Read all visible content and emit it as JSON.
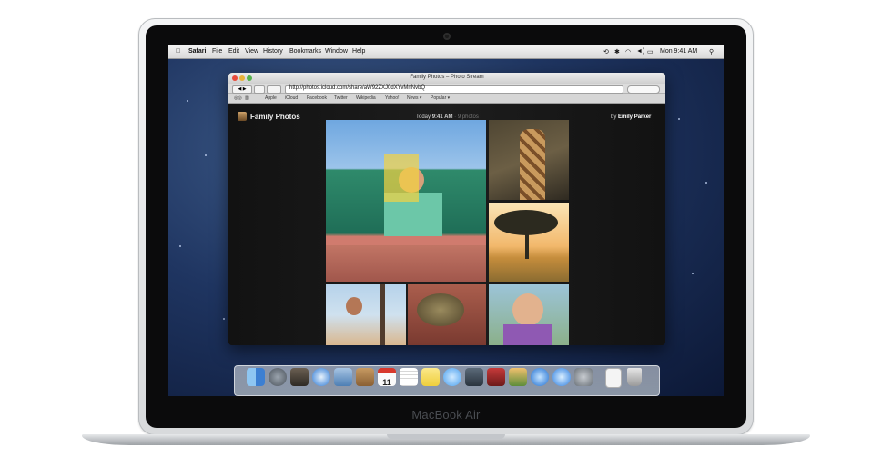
{
  "device": {
    "brand_label": "MacBook Air"
  },
  "menubar": {
    "apple_icon": "apple-icon",
    "items": [
      "Safari",
      "File",
      "Edit",
      "View",
      "History",
      "Bookmarks",
      "Window",
      "Help"
    ],
    "clock": "Mon 9:41 AM"
  },
  "window": {
    "title": "Family Photos – Photo Stream",
    "url": "http://photos.icloud.com/share/aW92ZXJ0dXYvMnNvbQ",
    "bookmarks": [
      "Apple",
      "iCloud",
      "Facebook",
      "Twitter",
      "Wikipedia",
      "Yahoo!",
      "News ▾",
      "Popular ▾"
    ]
  },
  "stream": {
    "title": "Family Photos",
    "today_label": "Today",
    "time": "9:41 AM",
    "count": "· 9 photos",
    "by_prefix": "by",
    "author": "Emily Parker"
  },
  "dock": {
    "icons": [
      "finder-icon",
      "launchpad-icon",
      "mission-control-icon",
      "safari-icon",
      "mail-icon",
      "contacts-icon",
      "calendar-icon",
      "reminders-icon",
      "notes-icon",
      "messages-icon",
      "facetime-icon",
      "photo-booth-icon",
      "iphoto-icon",
      "itunes-icon",
      "app-store-icon",
      "system-preferences-icon",
      "documents-icon",
      "trash-icon"
    ],
    "calendar_day": "11"
  },
  "colors": {
    "accent": "#2a6fd6",
    "desktop": "#1f3561",
    "window_dark": "#141414"
  }
}
